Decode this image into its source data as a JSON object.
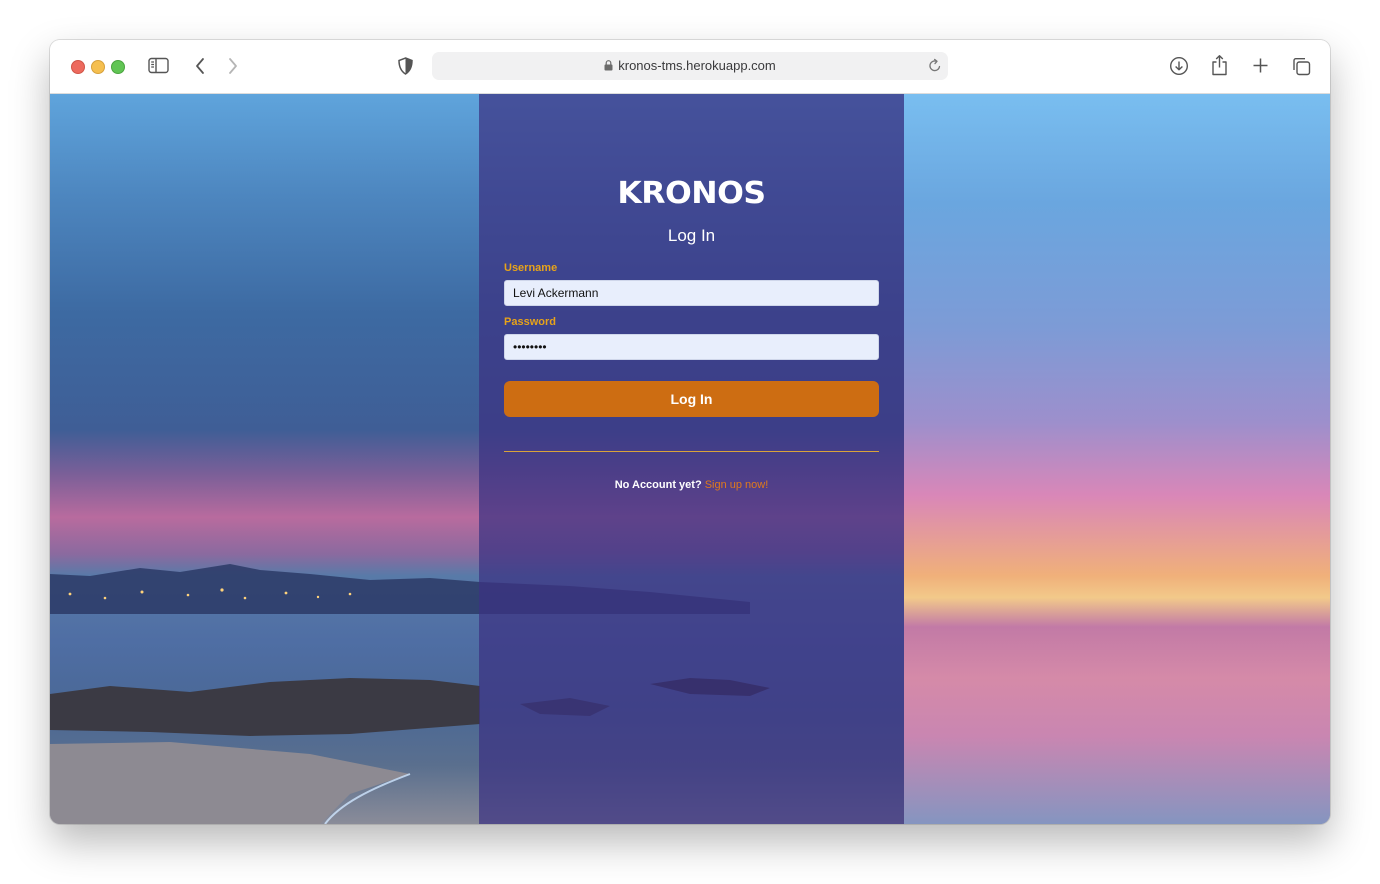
{
  "browser": {
    "url": "kronos-tms.herokuapp.com"
  },
  "login": {
    "logo": "KRONOS",
    "title": "Log In",
    "username_label": "Username",
    "username_value": "Levi Ackermann",
    "password_label": "Password",
    "password_value": "password",
    "submit_label": "Log In",
    "no_account_text": "No Account yet?",
    "signup_link": "Sign up now!"
  },
  "colors": {
    "panel": "#3c3282",
    "label": "#e7a31a",
    "button": "#cd6d12",
    "link": "#e07a1c"
  },
  "icons": [
    "sidebar-icon",
    "back-icon",
    "forward-icon",
    "shield-icon",
    "lock-icon",
    "reload-icon",
    "download-icon",
    "share-icon",
    "new-tab-icon",
    "tabs-overview-icon"
  ]
}
